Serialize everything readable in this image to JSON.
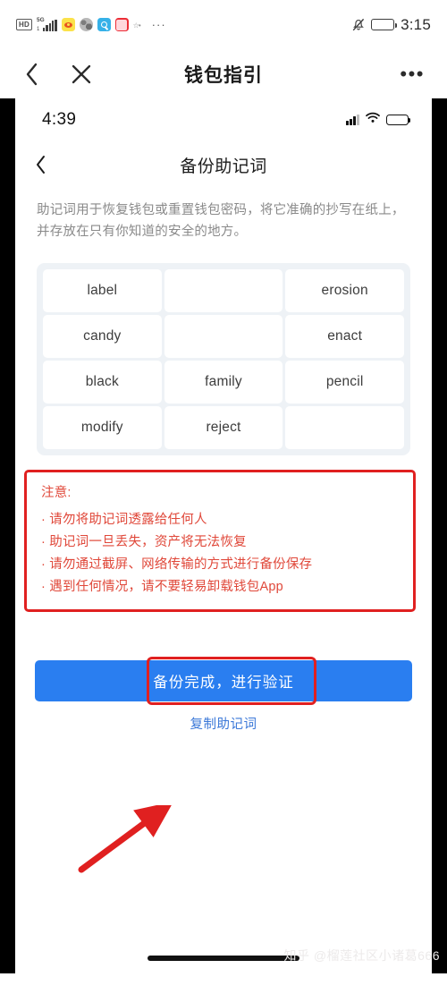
{
  "os_status": {
    "hd_label": "HD",
    "network_label": "5G",
    "network_sub": "1",
    "more_dots": "···",
    "icons": [
      "hd-badge",
      "signal-5g-icon",
      "weibo-icon",
      "globe-app-icon",
      "search-app-icon",
      "pink-app-icon",
      "gray-app-icon",
      "more-icon"
    ],
    "bell_icon": "bell-mute-icon",
    "battery_icon": "battery-full-icon",
    "time": "3:15"
  },
  "wechat_nav": {
    "back_icon": "chevron-left-icon",
    "close_icon": "close-icon",
    "title": "钱包指引",
    "more_icon": "more-horizontal-icon",
    "more_dots": "•••"
  },
  "inner": {
    "status": {
      "time": "4:39",
      "signal_icon": "cellular-signal-icon",
      "wifi_icon": "wifi-icon",
      "battery_icon": "battery-low-icon"
    },
    "nav": {
      "back_icon": "chevron-left-icon",
      "title": "备份助记词"
    },
    "description": "助记词用于恢复钱包或重置钱包密码，将它准确的抄写在纸上，并存放在只有你知道的安全的地方。",
    "mnemonic": {
      "columns": 3,
      "rows": 4,
      "cells": [
        "label",
        "",
        "erosion",
        "candy",
        "",
        "enact",
        "black",
        "family",
        "pencil",
        "modify",
        "reject",
        ""
      ]
    },
    "warning": {
      "title": "注意:",
      "items": [
        "· 请勿将助记词透露给任何人",
        "· 助记词一旦丢失，资产将无法恢复",
        "· 请勿通过截屏、网络传输的方式进行备份保存",
        "· 遇到任何情况，请不要轻易卸载钱包App"
      ]
    },
    "cta_button": "备份完成，进行验证",
    "copy_link": "复制助记词",
    "annotation": {
      "highlight_icon": "red-highlight-box",
      "arrow_icon": "red-arrow-icon"
    }
  },
  "watermark": "知乎 @榴莲社区小诸葛666",
  "colors": {
    "accent_blue": "#2a7ef0",
    "warning_red": "#e02020",
    "warning_text": "#e0483a",
    "link_blue": "#3b78d8",
    "grid_bg": "#eef2f6",
    "battery_yellow": "#f3c33c"
  }
}
